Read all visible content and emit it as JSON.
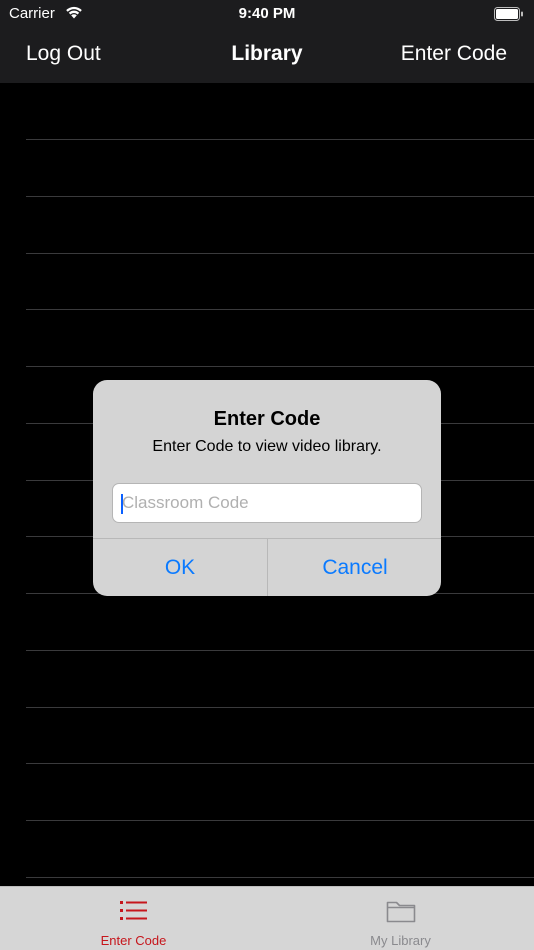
{
  "status_bar": {
    "carrier": "Carrier",
    "time": "9:40 PM"
  },
  "nav": {
    "left_label": "Log Out",
    "title": "Library",
    "right_label": "Enter Code"
  },
  "alert": {
    "title": "Enter Code",
    "message": "Enter Code to view video library.",
    "input_placeholder": "Classroom Code",
    "input_value": "",
    "ok_label": "OK",
    "cancel_label": "Cancel"
  },
  "tabs": [
    {
      "label": "Enter Code",
      "icon": "list-icon",
      "selected": true
    },
    {
      "label": "My Library",
      "icon": "folder-icon",
      "selected": false
    }
  ],
  "colors": {
    "accent": "#0a7aff",
    "tab_selected": "#c6161c",
    "tab_unselected": "#8a8a8e"
  }
}
